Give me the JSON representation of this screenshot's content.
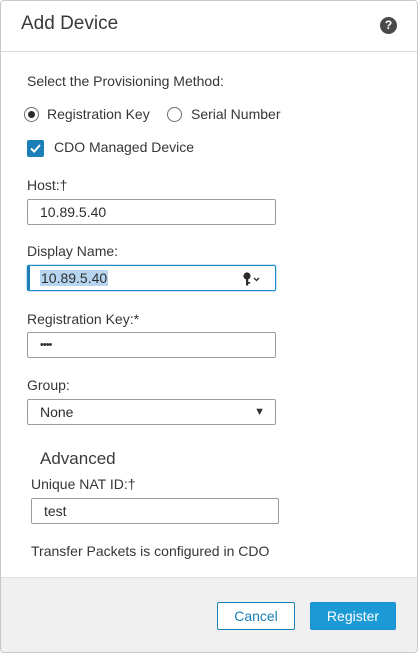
{
  "dialog": {
    "title": "Add Device",
    "help_icon": "question-mark-icon",
    "help_glyph": "?"
  },
  "provisioning": {
    "label": "Select the Provisioning Method:",
    "options": [
      {
        "label": "Registration Key",
        "selected": true
      },
      {
        "label": "Serial Number",
        "selected": false
      }
    ]
  },
  "cdo_managed": {
    "label": "CDO Managed Device",
    "checked": true
  },
  "host": {
    "label": "Host:†",
    "value": "10.89.5.40"
  },
  "display_name": {
    "label": "Display Name:",
    "value": "10.89.5.40",
    "icon": "key-icon"
  },
  "registration_key": {
    "label": "Registration Key:*",
    "value": "••••"
  },
  "group": {
    "label": "Group:",
    "selected": "None"
  },
  "advanced": {
    "title": "Advanced",
    "unique_nat_label": "Unique NAT ID:†",
    "unique_nat_value": "test",
    "transfer_packets_note": "Transfer Packets is configured in CDO"
  },
  "footer": {
    "cancel_label": "Cancel",
    "register_label": "Register"
  },
  "colors": {
    "accent": "#1a7fb8",
    "primary_button": "#1b9ad6",
    "footer_bg": "#f0f0f0",
    "selection_highlight": "#b7d5f0"
  }
}
